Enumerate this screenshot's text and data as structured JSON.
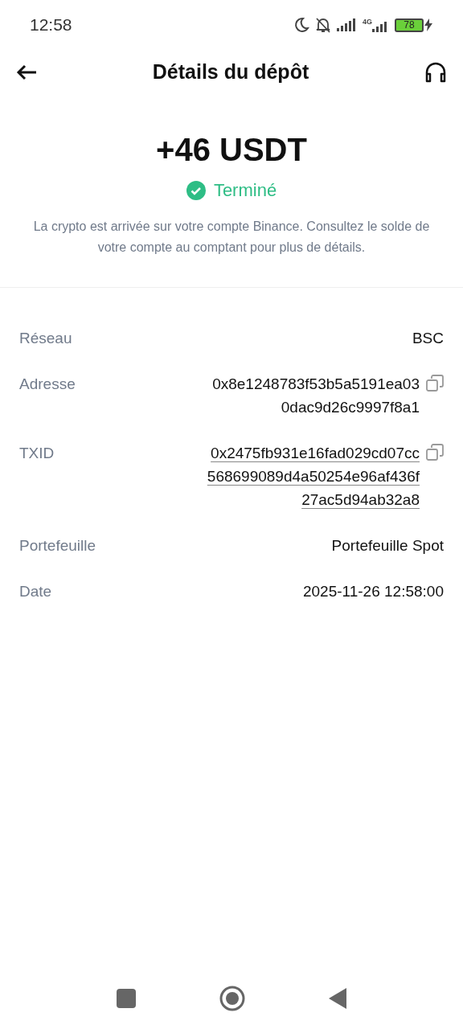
{
  "status_bar": {
    "time": "12:58",
    "network": "4G",
    "battery": "78"
  },
  "header": {
    "title": "Détails du dépôt"
  },
  "summary": {
    "amount": "+46 USDT",
    "status": "Terminé",
    "message": "La crypto est arrivée sur votre compte Binance. Consultez le solde de votre compte au comptant pour plus de détails."
  },
  "details": [
    {
      "label": "Réseau",
      "kind": "text",
      "lines": [
        "BSC"
      ]
    },
    {
      "label": "Adresse",
      "kind": "copyable",
      "lines": [
        "0x8e1248783f53b5a5191ea03",
        "0dac9d26c9997f8a1"
      ]
    },
    {
      "label": "TXID",
      "kind": "link",
      "lines": [
        "0x2475fb931e16fad029cd07cc",
        "568699089d4a50254e96af436f",
        "27ac5d94ab32a8"
      ]
    },
    {
      "label": "Portefeuille",
      "kind": "text",
      "lines": [
        "Portefeuille Spot"
      ]
    },
    {
      "label": "Date",
      "kind": "text",
      "lines": [
        "2025-11-26 12:58:00"
      ]
    }
  ]
}
